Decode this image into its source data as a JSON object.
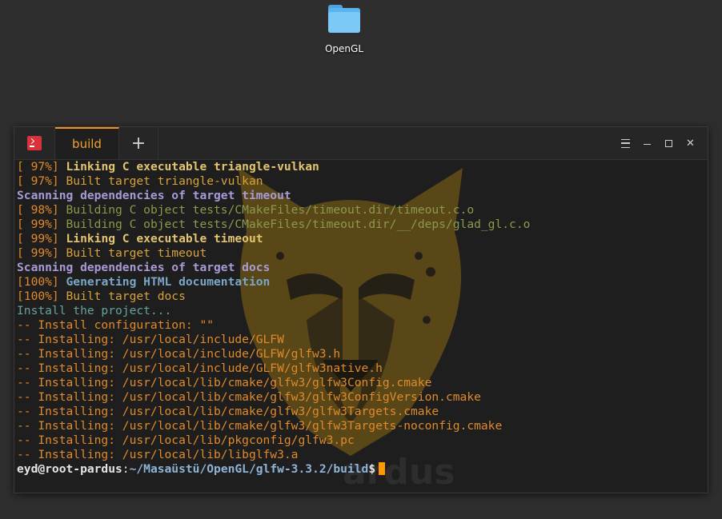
{
  "desktop": {
    "folder_label": "OpenGL"
  },
  "terminal": {
    "tab_label": "build",
    "add_tab_symbol": "+",
    "close_symbol": "✕",
    "lines": [
      {
        "prefix": "[ 97%] ",
        "text": "Linking C executable triangle-vulkan",
        "style": "yellow-bold"
      },
      {
        "prefix": "[ 97%] ",
        "text": "Built target triangle-vulkan",
        "style": "yellow"
      },
      {
        "prefix": "",
        "text": "Scanning dependencies of target timeout",
        "style": "violet-bold"
      },
      {
        "prefix": "[ 98%] ",
        "text": "Building C object tests/CMakeFiles/timeout.dir/timeout.c.o",
        "style": "green"
      },
      {
        "prefix": "[ 99%] ",
        "text": "Building C object tests/CMakeFiles/timeout.dir/__/deps/glad_gl.c.o",
        "style": "green"
      },
      {
        "prefix": "[ 99%] ",
        "text": "Linking C executable timeout",
        "style": "yellow-bold"
      },
      {
        "prefix": "[ 99%] ",
        "text": "Built target timeout",
        "style": "yellow"
      },
      {
        "prefix": "",
        "text": "Scanning dependencies of target docs",
        "style": "violet-bold"
      },
      {
        "prefix": "[100%] ",
        "text": "Generating HTML documentation",
        "style": "teal-bold"
      },
      {
        "prefix": "[100%] ",
        "text": "Built target docs",
        "style": "yellow"
      },
      {
        "prefix": "",
        "text": "Install the project...",
        "style": "teal"
      },
      {
        "prefix": "",
        "text": "-- Install configuration: \"\"",
        "style": "orange"
      },
      {
        "prefix": "",
        "text": "-- Installing: /usr/local/include/GLFW",
        "style": "orange"
      },
      {
        "prefix": "",
        "text": "-- Installing: /usr/local/include/GLFW/glfw3.h",
        "style": "orange"
      },
      {
        "prefix": "",
        "text": "-- Installing: /usr/local/include/GLFW/glfw3native.h",
        "style": "orange"
      },
      {
        "prefix": "",
        "text": "-- Installing: /usr/local/lib/cmake/glfw3/glfw3Config.cmake",
        "style": "orange"
      },
      {
        "prefix": "",
        "text": "-- Installing: /usr/local/lib/cmake/glfw3/glfw3ConfigVersion.cmake",
        "style": "orange"
      },
      {
        "prefix": "",
        "text": "-- Installing: /usr/local/lib/cmake/glfw3/glfw3Targets.cmake",
        "style": "orange"
      },
      {
        "prefix": "",
        "text": "-- Installing: /usr/local/lib/cmake/glfw3/glfw3Targets-noconfig.cmake",
        "style": "orange"
      },
      {
        "prefix": "",
        "text": "-- Installing: /usr/local/lib/pkgconfig/glfw3.pc",
        "style": "orange"
      },
      {
        "prefix": "",
        "text": "-- Installing: /usr/local/lib/libglfw3.a",
        "style": "orange"
      }
    ],
    "prompt": {
      "user_host": "eyd@root-pardus",
      "separator": ":",
      "path": "~/Masaüstü/OpenGL/glfw-3.3.2/build",
      "symbol": "$"
    }
  },
  "colors": {
    "accent": "#f09020",
    "cursor": "#ff9800",
    "app_icon": "#d8323c"
  },
  "icons": [
    "terminal-app-icon",
    "folder-icon",
    "menu-icon",
    "minimize-icon",
    "maximize-icon",
    "close-icon",
    "add-tab-icon"
  ]
}
